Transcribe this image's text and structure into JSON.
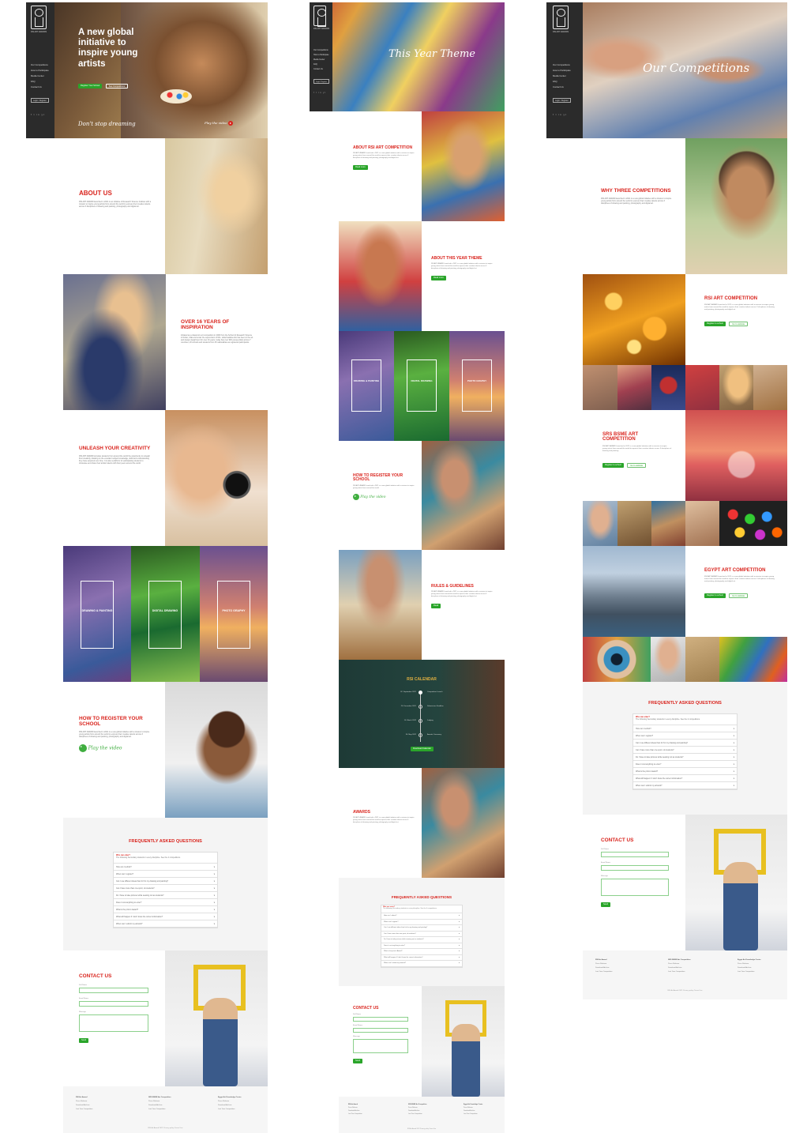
{
  "brand": {
    "name": "RSI ART AWARD",
    "short": "RSI ART AWARDS"
  },
  "sidebar": {
    "nav": [
      "Our Competitions",
      "How to Participate",
      "Media Center",
      "FAQ",
      "Contact Us"
    ],
    "login": "Login / Register",
    "social": "f t in yt"
  },
  "page1": {
    "hero": {
      "title": "A new global initiative to inspire young artists",
      "btn_primary": "Register Your School",
      "btn_secondary": "See Competitions",
      "tagline": "Don't stop dreaming",
      "play": "Play the video"
    },
    "about": {
      "title": "ABOUT US",
      "body": "RSI ART AWARD launched in 2021 is an initiative of Research Science Institute with a mission to inspire young artists from around the world to express their creative talents across 3 disciplines of drawing and painting, photography and digital art."
    },
    "inspiration": {
      "title": "OVER 16 YEARS OF INSPIRATION",
      "body": "Initiated as a classroom art competition in 2006 from the School of Research Science in Dubai, UAE and under the supervision of Mrs. Lidia Kadaba who has been in the art and design department for over 16 years, today has over 900 young artists across 7 countries, 20 schools and students from 45 nationalities as registered participants.",
      "link": "Mrs. Lidia Kadaba"
    },
    "creativity": {
      "title": "UNLEASH YOUR CREATIVITY",
      "body": "RSI ART AWARD provides students from around the world the opportunity to unleash their creativity, drawing on the excellent subject knowledge, skills and understanding they have acquired over time. It is also a platform for participating students to showcase and share their artistic talents with their peers around the world."
    },
    "categories": [
      "DRAWING & PAINTING",
      "DIGITAL DRAWING",
      "PHOTO GRAPHY"
    ],
    "register": {
      "title": "HOW TO REGISTER YOUR SCHOOL",
      "body": "RSI ART AWARD launched in 2021 is a new global initiative with a mission to inspire young artists from around the world to express their creative talents across 3 disciplines of drawing and painting, photography and digital art.",
      "play": "Play the video"
    }
  },
  "faq": {
    "title": "FREQUENTLY ASKED QUESTIONS",
    "open_q": "Who can enter?",
    "open_a": "The following Secondary students in every discipline. See the 4 competitions.",
    "items": [
      "How can I submit?",
      "When can I register?",
      "Can I use different ideas than for for my drawing and painting?",
      "Can I have more than one sport, do students?",
      "Do I have to take pictures while wearing not as students?",
      "Does it cost anything to enter?",
      "What is the prize's Award?",
      "What will happen if I don't know the correct information?",
      "When can I submit my artwork?"
    ]
  },
  "contact": {
    "title": "CONTACT US",
    "fields": [
      "Full Name",
      "Email Name",
      "Message"
    ],
    "send": "Send"
  },
  "footer": {
    "cols": [
      {
        "title": "RSI Art Award",
        "items": [
          "Press Release",
          "Download Archive",
          "Last Year Competition"
        ]
      },
      {
        "title": "SRS BSME Art Competition",
        "items": [
          "Press Release",
          "Download Archive",
          "Last Year Competition"
        ]
      },
      {
        "title": "Egypt Art Knowledge Centre",
        "items": [
          "Press Release",
          "Download Archive",
          "Last Year Competition"
        ]
      }
    ],
    "copyright": "RSI Art Award 2021 Privacy policy Terms Use"
  },
  "page2": {
    "hero_title": "This Year Theme",
    "about_comp": {
      "title": "ABOUT RSI ART COMPETITION",
      "body": "RSI ART AWARD launched in 2021 is a new global initiative with a mission to inspire young artists from around the world to express their creative talents across 3 disciplines of drawing and painting, photography and digital art.",
      "btn": "Read more"
    },
    "about_theme": {
      "title": "ABOUT THIS YEAR THEME",
      "body": "RSI ART AWARD launched in 2021 is a new global initiative with a mission to inspire young artists from around the world to express their creative talents across 3 disciplines of drawing and painting, photography and digital art.",
      "btn": "Read more"
    },
    "categories": [
      "DRAWING & PAINTING",
      "DIGITAL DRAWING",
      "PHOTO GRAPHY"
    ],
    "register": {
      "title": "HOW TO REGISTER YOUR SCHOOL",
      "body": "RSI ART AWARD launched in 2021 is a new global initiative with a mission to inspire young artists from around the world.",
      "play": "Play the video"
    },
    "rules": {
      "title": "RULES & GUIDELINES",
      "body": "RSI ART AWARD launched in 2021 is a new global initiative with a mission to inspire young artists from around the world to express their creative talents across 3 disciplines of drawing and painting, photography and digital art.",
      "btn": "Read"
    },
    "calendar": {
      "title": "RSI CALENDAR",
      "events": [
        {
          "date": "02. September 2021",
          "label": "Competition Launch"
        },
        {
          "date": "20. December 2021",
          "label": "Submission Deadline"
        },
        {
          "date": "10. March 2022",
          "label": "Judging"
        },
        {
          "date": "30. May 2022",
          "label": "Awards Ceremony"
        }
      ],
      "btn": "Download Calendar"
    },
    "awards": {
      "title": "AWARDS",
      "body": "RSI ART AWARD launched in 2021 is a new global initiative with a mission to inspire young artists from around the world to express their creative talents across 3 disciplines of drawing and painting, photography and digital art."
    }
  },
  "page3": {
    "hero_title": "Our Competitions",
    "why": {
      "title": "WHY THREE COMPETITIONS",
      "body": "RSI ART AWARD launched in 2021 is a new global initiative with a mission to inspire young artists from around the world to express their creative talents across 3 disciplines of drawing and painting, photography and digital art."
    },
    "rsi": {
      "title": "RSI ART COMPETITION",
      "body": "RSI ART AWARD launched in 2021 is a new global initiative with a mission to inspire young artists from around the world to express their creative talents across 3 disciplines of drawing and painting, photography and digital art.",
      "btn1": "Register to school",
      "btn2": "Go to website"
    },
    "srs": {
      "title": "SRS BSME ART COMPETITION",
      "body": "RSI ART AWARD launched in 2021 is a new global initiative with a mission to inspire young artists from around the world to express their creative talents across 3 disciplines of drawing and painting.",
      "btn1": "Register to school",
      "btn2": "Go to website"
    },
    "egypt": {
      "title": "EGYPT ART COMPETITION",
      "body": "RSI ART AWARD launched in 2021 is a new global initiative with a mission to inspire young artists from around the world to express their creative talents across 3 disciplines of drawing and painting, photography and digital art.",
      "btn1": "Register to school",
      "btn2": "Go to website"
    }
  }
}
